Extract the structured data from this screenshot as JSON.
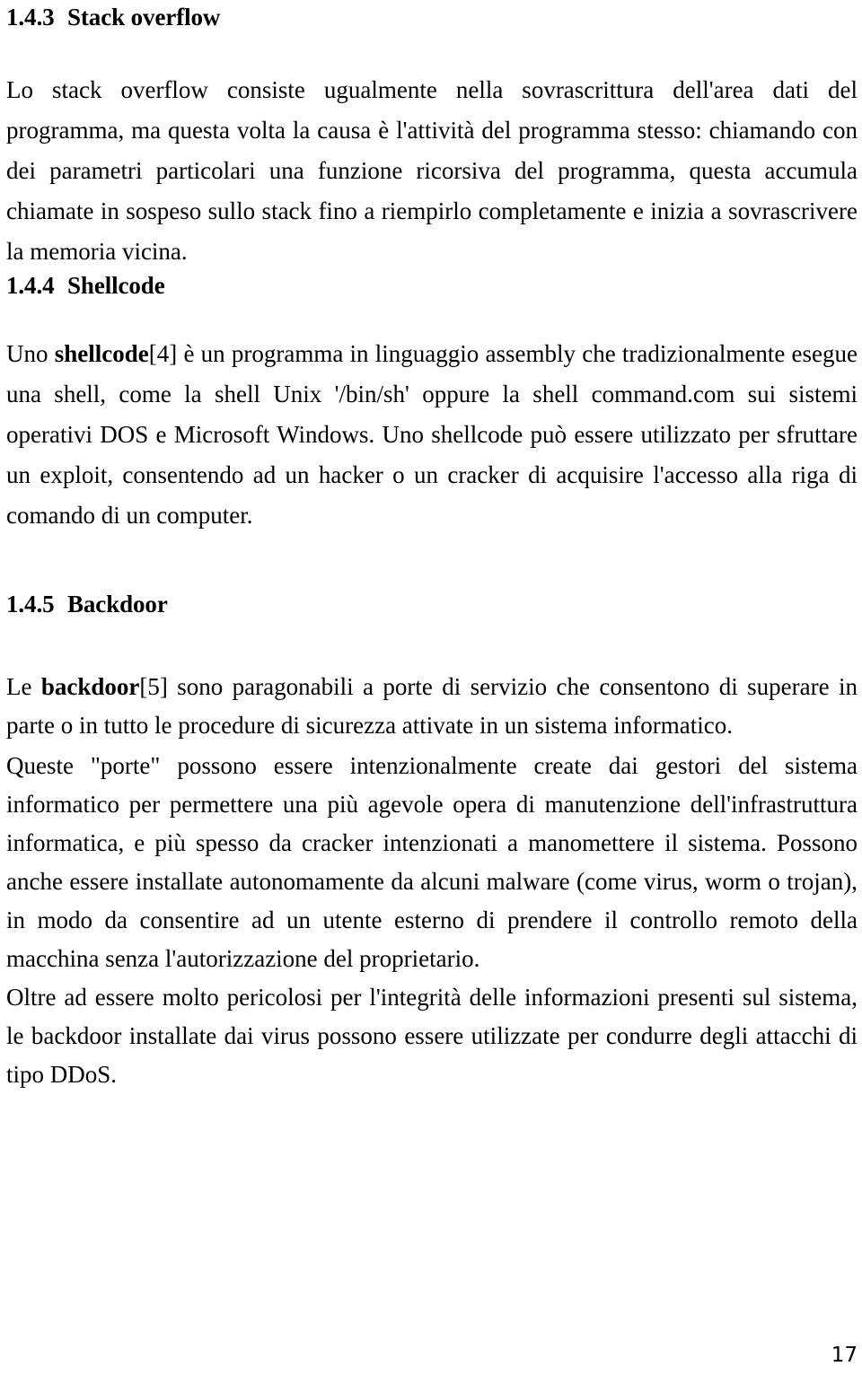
{
  "document": {
    "language": "it",
    "page_number": "17",
    "background_color": "#ffffff",
    "text_color": "#000000"
  },
  "sections": [
    {
      "number": "1.4.3",
      "title": "Stack overflow",
      "paragraphs": [
        {
          "id": "stack-overflow-body",
          "runs": [
            {
              "text": "Lo stack overflow consiste ugualmente nella sovrascrittura dell'area dati del programma, ma questa volta la causa è l'attività del programma stesso: chiamando con dei parametri particolari una funzione ricorsiva del programma, questa accumula chiamate in sospeso sullo stack fino a riempirlo completamente e inizia a sovrascrivere la memoria vicina.",
              "bold": false
            }
          ]
        }
      ]
    },
    {
      "number": "1.4.4",
      "title": "Shellcode",
      "paragraphs": [
        {
          "id": "shellcode-body",
          "runs": [
            {
              "text": "Uno ",
              "bold": false
            },
            {
              "text": "shellcode",
              "bold": true
            },
            {
              "text": "[4] è un programma in linguaggio assembly che tradizionalmente esegue una shell, come la shell Unix '/bin/sh' oppure la shell command.com sui sistemi operativi DOS e Microsoft Windows. Uno shellcode può essere utilizzato per sfruttare un exploit, consentendo ad un hacker o un cracker di acquisire l'accesso alla riga di comando di un computer.",
              "bold": false
            }
          ]
        }
      ]
    },
    {
      "number": "1.4.5",
      "title": "Backdoor",
      "paragraphs": [
        {
          "id": "backdoor-body-1",
          "runs": [
            {
              "text": "Le ",
              "bold": false
            },
            {
              "text": "backdoor",
              "bold": true
            },
            {
              "text": "[5] sono paragonabili a porte di servizio che consentono di superare in parte o in tutto le procedure di sicurezza attivate in un sistema informatico.",
              "bold": false
            }
          ]
        },
        {
          "id": "backdoor-body-2",
          "runs": [
            {
              "text": "Queste \"porte\" possono essere intenzionalmente create dai gestori del sistema informatico per permettere una più agevole opera di manutenzione dell'infrastruttura informatica, e più spesso da cracker intenzionati a manomettere il sistema. Possono anche essere installate autonomamente da alcuni malware (come virus, worm o trojan), in modo da consentire ad un utente esterno di prendere il controllo remoto della macchina senza l'autorizzazione del proprietario.",
              "bold": false
            }
          ]
        },
        {
          "id": "backdoor-body-3",
          "runs": [
            {
              "text": "Oltre ad essere molto pericolosi per l'integrità delle informazioni presenti sul sistema, le backdoor installate dai virus possono essere utilizzate per condurre degli attacchi di tipo DDoS.",
              "bold": false
            }
          ]
        }
      ]
    }
  ]
}
